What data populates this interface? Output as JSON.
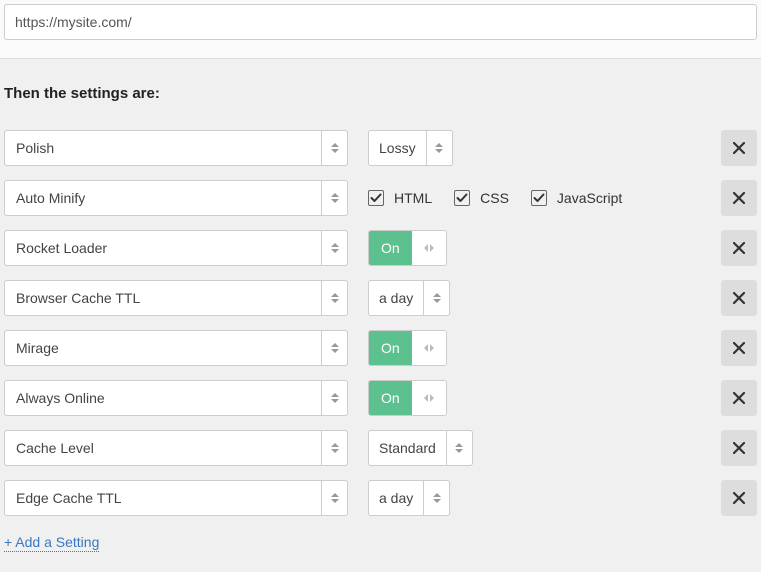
{
  "url_value": "https://mysite.com/",
  "heading": "Then the settings are:",
  "checkbox_labels": {
    "html": "HTML",
    "css": "CSS",
    "js": "JavaScript"
  },
  "toggle_on_label": "On",
  "rows": [
    {
      "setting": "Polish",
      "type": "select",
      "value": "Lossy"
    },
    {
      "setting": "Auto Minify",
      "type": "checkboxes"
    },
    {
      "setting": "Rocket Loader",
      "type": "toggle"
    },
    {
      "setting": "Browser Cache TTL",
      "type": "select",
      "value": "a day"
    },
    {
      "setting": "Mirage",
      "type": "toggle"
    },
    {
      "setting": "Always Online",
      "type": "toggle"
    },
    {
      "setting": "Cache Level",
      "type": "select",
      "value": "Standard"
    },
    {
      "setting": "Edge Cache TTL",
      "type": "select",
      "value": "a day"
    }
  ],
  "add_link": "+ Add a Setting"
}
